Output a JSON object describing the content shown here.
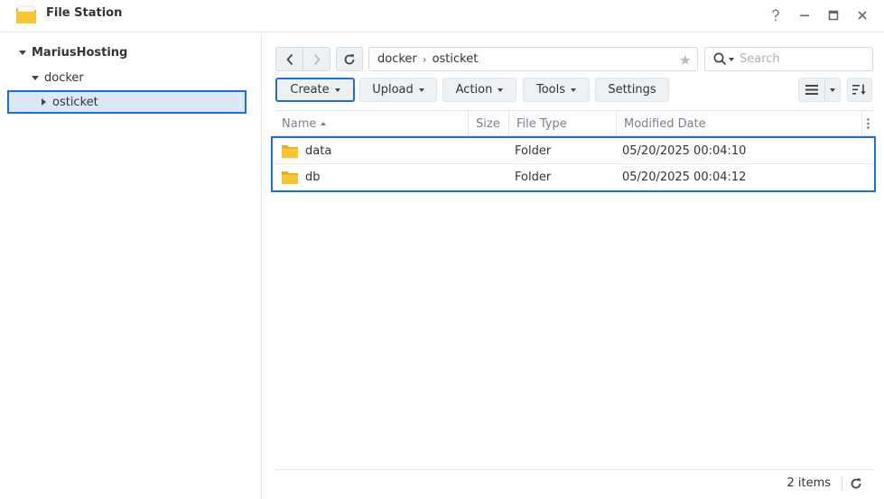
{
  "window": {
    "title": "File Station",
    "icon": "folder-icon",
    "controls": [
      "help-icon",
      "minimize-icon",
      "maximize-icon",
      "close-icon"
    ]
  },
  "sidebar": {
    "root_label": "MariusHosting",
    "folder_label": "docker",
    "selected_label": "osticket"
  },
  "toolbar": {
    "path": [
      "docker",
      "osticket"
    ],
    "path_separator": "›",
    "search_placeholder": "Search",
    "create_label": "Create",
    "upload_label": "Upload",
    "action_label": "Action",
    "tools_label": "Tools",
    "settings_label": "Settings"
  },
  "table": {
    "columns": {
      "name": "Name",
      "size": "Size",
      "type": "File Type",
      "date": "Modified Date"
    },
    "rows": [
      {
        "name": "data",
        "size": "",
        "type": "Folder",
        "date": "05/20/2025 00:04:10"
      },
      {
        "name": "db",
        "size": "",
        "type": "Folder",
        "date": "05/20/2025 00:04:12"
      }
    ]
  },
  "status": {
    "count_text": "2 items"
  },
  "colors": {
    "highlight_border": "#1a6ee0",
    "selection_bg": "#dde8f7",
    "folder_yellow": "#f6c02e",
    "button_bg": "#eef1f4"
  }
}
